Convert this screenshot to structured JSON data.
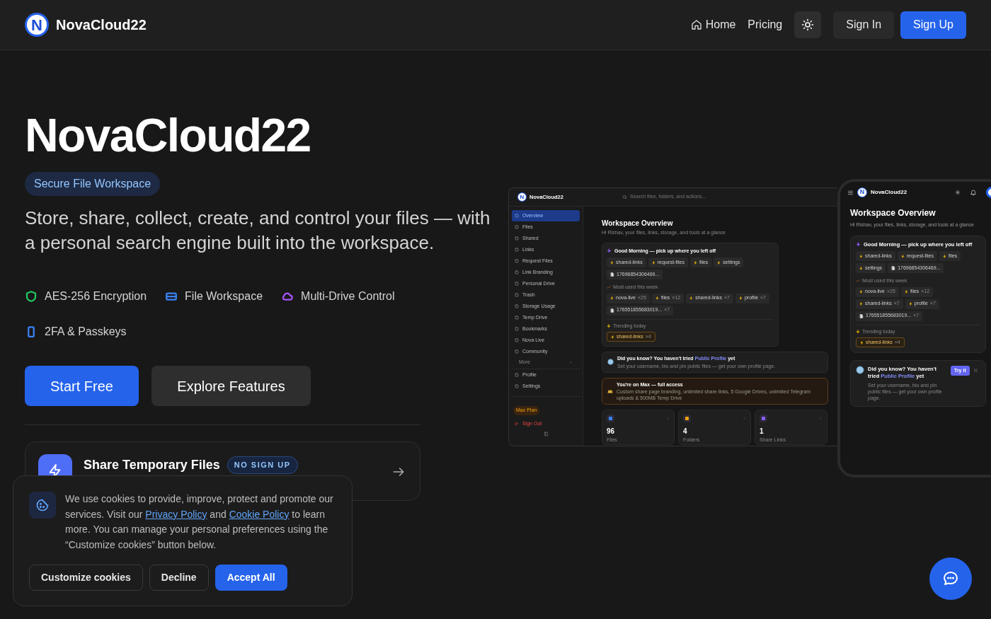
{
  "nav": {
    "logo_letter": "N",
    "brand": "NovaCloud22",
    "links": [
      {
        "label": "Home",
        "kind": "home"
      },
      {
        "label": "Pricing",
        "kind": "plain"
      }
    ],
    "buttons": [
      {
        "label": "Sign In",
        "kind": "ghost"
      },
      {
        "label": "Sign Up",
        "kind": "primary"
      }
    ]
  },
  "hero": {
    "title": "NovaCloud22",
    "badge": "Secure File Workspace",
    "subtitle": "Store, share, collect, create, and control your files — with a personal search engine built into the workspace.",
    "features": [
      {
        "label": "AES-256 Encryption",
        "kind": "shield",
        "color": "#22c55e"
      },
      {
        "label": "File Workspace",
        "kind": "drive",
        "color": "#3b82f6"
      },
      {
        "label": "Multi-Drive Control",
        "kind": "cloud",
        "color": "#a855f7"
      },
      {
        "label": "2FA & Passkeys",
        "kind": "phone",
        "color": "#3b82f6"
      }
    ],
    "buttons": [
      {
        "label": "Start Free",
        "kind": "primary"
      },
      {
        "label": "Explore Features",
        "kind": "secondary"
      }
    ],
    "promo": {
      "title": "Share Temporary Files",
      "badge": "NO SIGN UP"
    }
  },
  "desktop_preview": {
    "logo_letter": "N",
    "brand": "NovaCloud22",
    "search_placeholder": "Search files, folders, and actions...",
    "sidebar": [
      {
        "label": "Overview",
        "selected": true
      },
      {
        "label": "Files",
        "selected": false
      },
      {
        "label": "Shared",
        "selected": false
      },
      {
        "label": "Links",
        "selected": false
      },
      {
        "label": "Request Files",
        "selected": false
      },
      {
        "label": "Link Branding",
        "selected": false
      },
      {
        "label": "Personal Drive",
        "selected": false
      },
      {
        "label": "Trash",
        "selected": false
      },
      {
        "label": "Storage Usage",
        "selected": false
      },
      {
        "label": "Temp Drive",
        "selected": false
      },
      {
        "label": "Bookmarks",
        "selected": false
      },
      {
        "label": "Nova Live",
        "selected": false
      },
      {
        "label": "Community",
        "selected": false
      }
    ],
    "more": "More",
    "sidebar_bottom": [
      {
        "label": "Profile",
        "selected": false
      },
      {
        "label": "Settings",
        "selected": false
      }
    ],
    "plan_badge": "Max Plan",
    "sign_out": "Sign Out",
    "overview": {
      "title": "Workspace Overview",
      "subtitle": "Hi Rishav, your files, links, storage, and tools at a glance",
      "greeting": "Good Morning — pick up where you left off",
      "recent": [
        "shared-links",
        "request-files",
        "files",
        "settings"
      ],
      "recent_file": "17696854306469...",
      "most_used_label": "Most used this week",
      "most_used": [
        {
          "label": "nova-live",
          "count": "×25"
        },
        {
          "label": "files",
          "count": "×12"
        },
        {
          "label": "shared-links",
          "count": "×7"
        },
        {
          "label": "profile",
          "count": "×7"
        }
      ],
      "most_used_file": {
        "label": "176551855683019...",
        "count": "×7"
      },
      "trending_label": "Trending today",
      "trending": [
        {
          "label": "shared-links",
          "count": "×4"
        }
      ],
      "tip": {
        "before": "Did you know? You haven't tried ",
        "link": "Public Profile",
        "after": " yet",
        "detail": "Set your username, bio and pin public files — get your own profile page."
      }
    },
    "plan_banner": {
      "title": "You're on Max — full access",
      "detail": "Custom share page branding, unlimited share links, 5 Google Drives, unlimited Telegram uploads & 500MB Temp Drive"
    },
    "stats": [
      {
        "value": "96",
        "label": "Files",
        "color": "#3b82f6"
      },
      {
        "value": "4",
        "label": "Folders",
        "color": "#f59e0b"
      },
      {
        "value": "1",
        "label": "Share Links",
        "color": "#8b5cf6"
      }
    ]
  },
  "mobile_preview": {
    "logo_letter": "N",
    "brand": "NovaCloud22",
    "overview": {
      "title": "Workspace Overview",
      "subtitle": "Hi Rishav, your files, links, storage, and tools at a glance",
      "greeting": "Good Morning — pick up where you left off",
      "recent": [
        "shared-links",
        "request-files",
        "files",
        "settings"
      ],
      "recent_file": "17696854306469...",
      "most_used_label": "Most used this week",
      "most_used": [
        {
          "label": "nova-live",
          "count": "×25"
        },
        {
          "label": "files",
          "count": "×12"
        },
        {
          "label": "shared-links",
          "count": "×7"
        },
        {
          "label": "profile",
          "count": "×7"
        }
      ],
      "most_used_file": {
        "label": "176551855683019...",
        "count": "×7"
      },
      "trending_label": "Trending today",
      "trending": [
        {
          "label": "shared-links",
          "count": "×4"
        }
      ],
      "tip": {
        "before": "Did you know? You haven't tried ",
        "link": "Public Profile",
        "after": " yet",
        "detail": "Set your username, bio and pin public files — get your own profile page.",
        "action": "Try it"
      }
    }
  },
  "cookie_banner": {
    "parts": [
      {
        "kind": "text",
        "text": "We use cookies to provide, improve, protect and promote our services. Visit our "
      },
      {
        "kind": "link",
        "text": "Privacy Policy"
      },
      {
        "kind": "text",
        "text": " and "
      },
      {
        "kind": "link",
        "text": "Cookie Policy"
      },
      {
        "kind": "text",
        "text": " to learn more. You can manage your personal preferences using the “Customize cookies” button below."
      }
    ],
    "buttons": [
      {
        "label": "Customize cookies",
        "kind": "outline"
      },
      {
        "label": "Decline",
        "kind": "outline"
      },
      {
        "label": "Accept All",
        "kind": "primary"
      }
    ]
  }
}
